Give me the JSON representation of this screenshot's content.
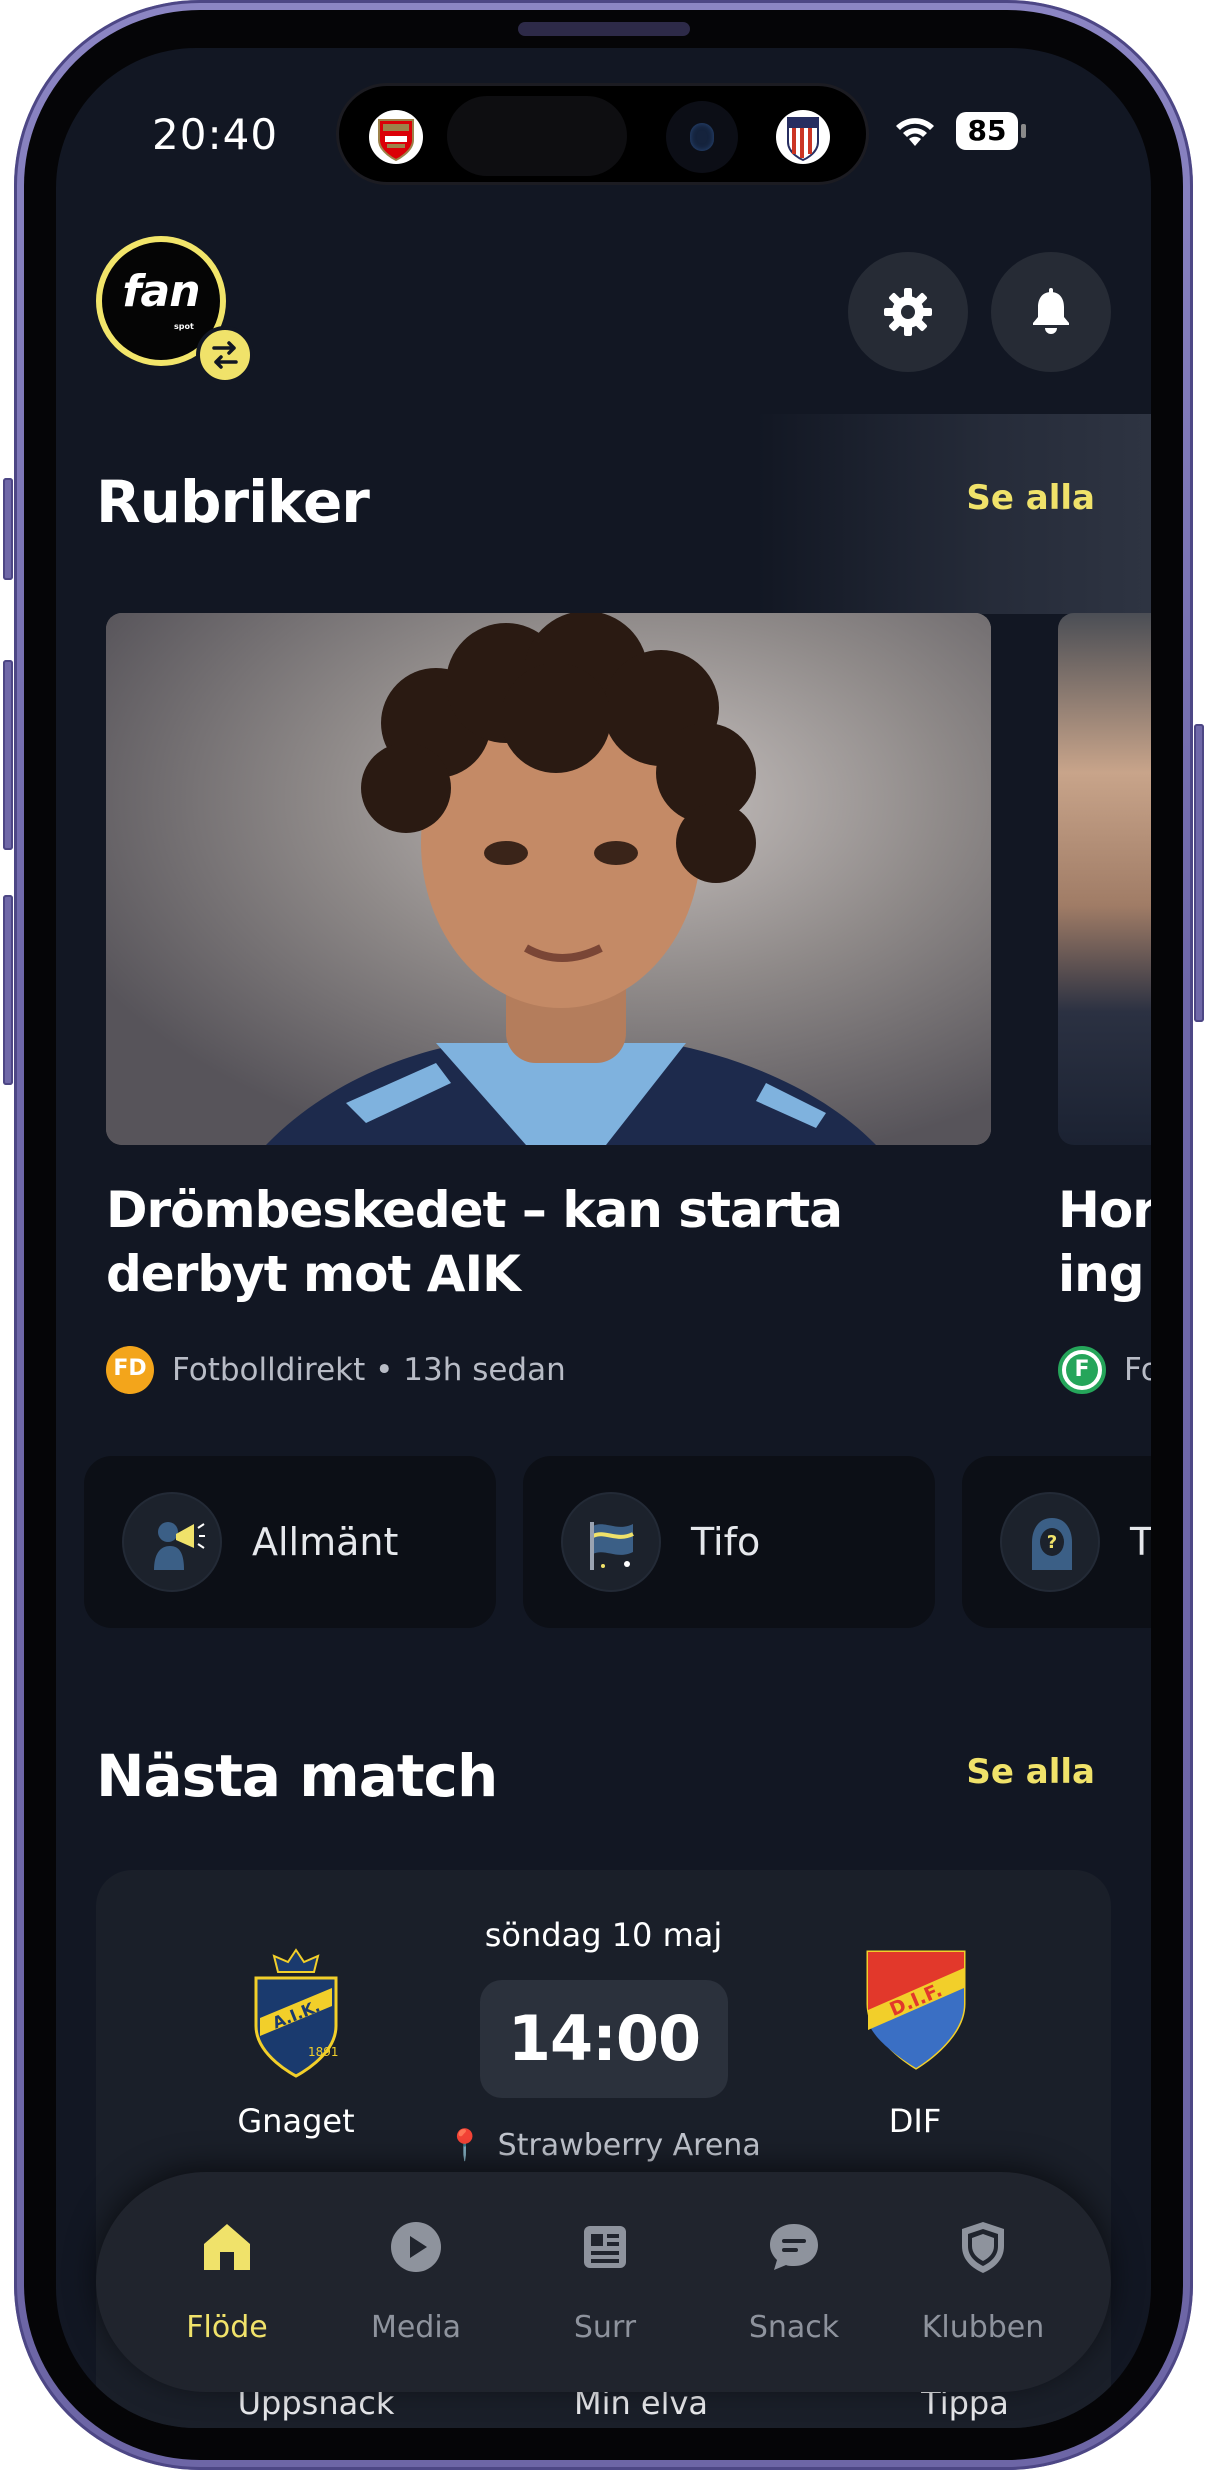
{
  "status_bar": {
    "time": "20:40",
    "battery": "85",
    "island_left_icon": "arsenal-crest-icon",
    "island_right_icon": "atletico-madrid-crest-icon"
  },
  "header": {
    "logo_text": "fan",
    "logo_subtext": "spot",
    "switch_icon": "swap-arrows-icon",
    "settings_icon": "gear-icon",
    "notifications_icon": "bell-icon"
  },
  "headlines": {
    "title": "Rubriker",
    "see_all": "Se alla",
    "articles": [
      {
        "title": "Drömbeskedet – kan starta\nderbyt mot AIK",
        "source": "Fotbolldirekt",
        "age": "13h sedan",
        "source_line": "Fotbolldirekt • 13h sedan",
        "source_icon_text": "FD"
      },
      {
        "title_visible": "Hor\ning",
        "source_visible": "Fo",
        "source_icon_text": "F"
      }
    ]
  },
  "categories": [
    {
      "label": "Allmänt",
      "icon": "megaphone-fan-icon"
    },
    {
      "label": "Tifo",
      "icon": "flag-icon"
    },
    {
      "label": "Tr",
      "icon": "hooded-question-icon"
    }
  ],
  "next_match": {
    "title": "Nästa match",
    "see_all": "Se alla",
    "date": "söndag 10 maj",
    "kickoff": "14:00",
    "home_team": "Gnaget",
    "away_team": "DIF",
    "venue": "Strawberry Arena",
    "home_crest_icon": "aik-crest-icon",
    "away_crest_icon": "djurgarden-crest-icon",
    "actions": [
      "Uppsnack",
      "Min elva",
      "Tippa"
    ]
  },
  "tabbar": {
    "items": [
      {
        "label": "Flöde",
        "icon": "home-icon",
        "active": true
      },
      {
        "label": "Media",
        "icon": "play-icon",
        "active": false
      },
      {
        "label": "Surr",
        "icon": "news-icon",
        "active": false
      },
      {
        "label": "Snack",
        "icon": "chat-icon",
        "active": false
      },
      {
        "label": "Klubben",
        "icon": "shield-icon",
        "active": false
      }
    ]
  },
  "colors": {
    "background": "#121723",
    "accent": "#f0e26a",
    "card": "#1a1f29",
    "tabbar": "#20242d",
    "frame": "#6e67a9"
  }
}
